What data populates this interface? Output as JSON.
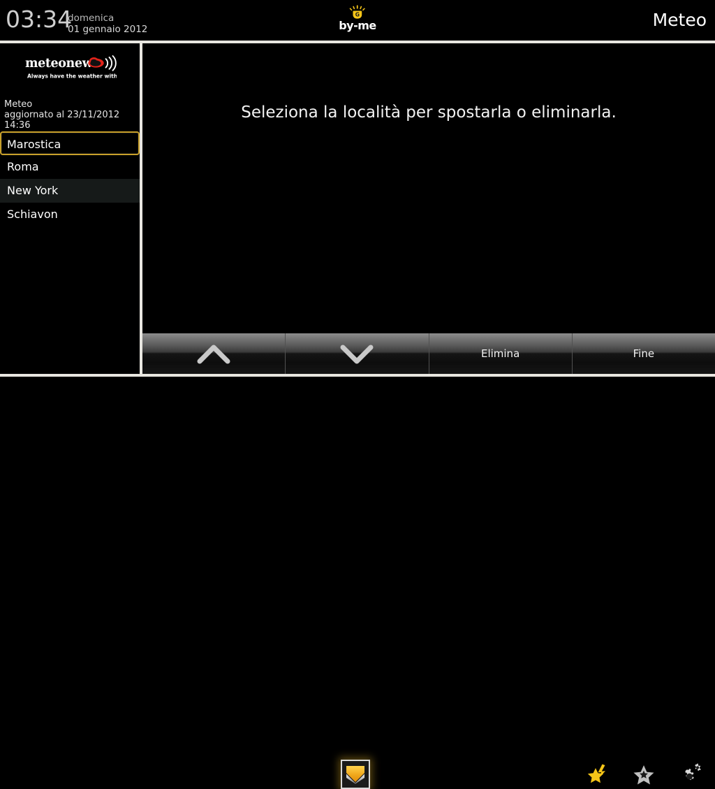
{
  "statusbar": {
    "time": "03:34",
    "day_name": "domenica",
    "date": "01 gennaio 2012",
    "brand_name": "by-me",
    "brand_icon": "sun-hand-icon",
    "page_title": "Meteo"
  },
  "sidebar": {
    "provider_logo": {
      "name": "meteonews",
      "tagline": "Always have the weather with you.",
      "cloud_color": "#e2231a",
      "icon": "meteonews-cloud-signal-icon"
    },
    "updated": {
      "title": "Meteo",
      "subtitle": "aggiornato al 23/11/2012 14:36"
    },
    "locations": [
      {
        "label": "Marostica",
        "selected": true
      },
      {
        "label": "Roma",
        "selected": false
      },
      {
        "label": "New York",
        "selected": false
      },
      {
        "label": "Schiavon",
        "selected": false
      }
    ]
  },
  "main": {
    "message": "Seleziona la località per spostarla o eliminarla."
  },
  "toolbar": {
    "buttons": [
      {
        "label": "",
        "icon": "chevron-up-icon",
        "name": "move-up-button"
      },
      {
        "label": "",
        "icon": "chevron-down-icon",
        "name": "move-down-button"
      },
      {
        "label": "Elimina",
        "icon": "",
        "name": "delete-button"
      },
      {
        "label": "Fine",
        "icon": "",
        "name": "done-button"
      }
    ]
  },
  "bottombar": {
    "home_icon": "home-down-arrow-icon",
    "nav_icons": [
      {
        "name": "scenario-star-bolt-icon",
        "color": "#f5c518"
      },
      {
        "name": "favorites-star-icon",
        "color": "#bfbfbf"
      },
      {
        "name": "settings-gears-icon",
        "color": "#d9d9d9"
      }
    ]
  },
  "colors": {
    "accent_gold": "#c8a02a",
    "divider": "#e8e6e0",
    "background": "#000000",
    "alt_row": "#161a19"
  }
}
